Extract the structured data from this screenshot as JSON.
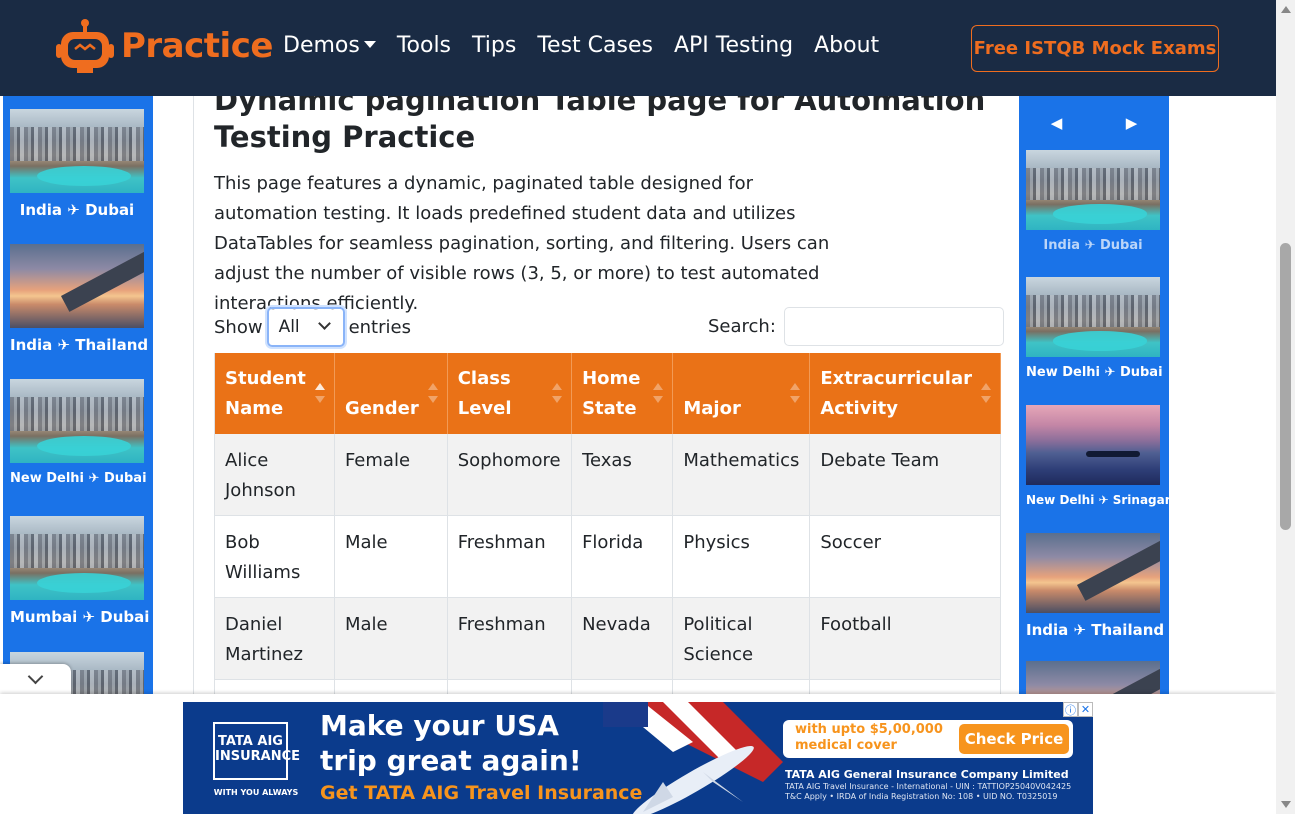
{
  "nav": {
    "brand": "Practice",
    "links": [
      "Demos",
      "Tools",
      "Tips",
      "Test Cases",
      "API Testing",
      "About"
    ],
    "cta": "Free ISTQB Mock Exams",
    "brand_color": "#ef6d1f",
    "bg_color": "#1a2b44"
  },
  "left_rail": {
    "cards": [
      {
        "caption": "India ✈ Dubai",
        "image": "city"
      },
      {
        "caption": "India ✈ Thailand",
        "image": "sunset"
      },
      {
        "caption": "New Delhi ✈ Dubai",
        "image": "city"
      },
      {
        "caption": "Mumbai ✈ Dubai",
        "image": "city"
      },
      {
        "caption": "",
        "image": "city"
      }
    ]
  },
  "right_rail": {
    "prev": "◀",
    "next": "▶",
    "cards": [
      {
        "caption": "India ✈ Dubai",
        "image": "city"
      },
      {
        "caption": "New Delhi ✈ Dubai",
        "image": "city"
      },
      {
        "caption": "New Delhi ✈ Srinagar",
        "image": "lake"
      },
      {
        "caption": "India ✈ Thailand",
        "image": "sunset"
      },
      {
        "caption": "",
        "image": "sunset"
      }
    ]
  },
  "main": {
    "title": "Dynamic pagination Table page for Automation Testing Practice",
    "description": "This page features a dynamic, paginated table designed for automation testing. It loads predefined student data and utilizes DataTables for seamless pagination, sorting, and filtering. Users can adjust the number of visible rows (3, 5, or more) to test automated interactions efficiently.",
    "show_label": "Show",
    "entries_label": "entries",
    "length_value": "All",
    "search_label": "Search:",
    "search_value": ""
  },
  "table": {
    "headers": [
      "Student Name",
      "Gender",
      "Class Level",
      "Home State",
      "Major",
      "Extracurricular Activity"
    ],
    "rows": [
      [
        "Alice Johnson",
        "Female",
        "Sophomore",
        "Texas",
        "Mathematics",
        "Debate Team"
      ],
      [
        "Bob Williams",
        "Male",
        "Freshman",
        "Florida",
        "Physics",
        "Soccer"
      ],
      [
        "Daniel Martinez",
        "Male",
        "Freshman",
        "Nevada",
        "Political Science",
        "Football"
      ]
    ],
    "header_color": "#ea7217"
  },
  "ad": {
    "logo": "TATA AIG INSURANCE",
    "logo_sub": "WITH YOU ALWAYS",
    "headline": "Make your USA trip great again!",
    "subline": "Get TATA AIG Travel Insurance",
    "offer": "with upto $5,00,000 medical cover",
    "button": "Check Price",
    "company": "TATA AIG General Insurance Company Limited",
    "fine_print": "TATA AIG Travel Insurance - International - UIN : TATTIOP25040V042425 T&C Apply • IRDA of India Registration No: 108 • UID NO. T0325019"
  }
}
